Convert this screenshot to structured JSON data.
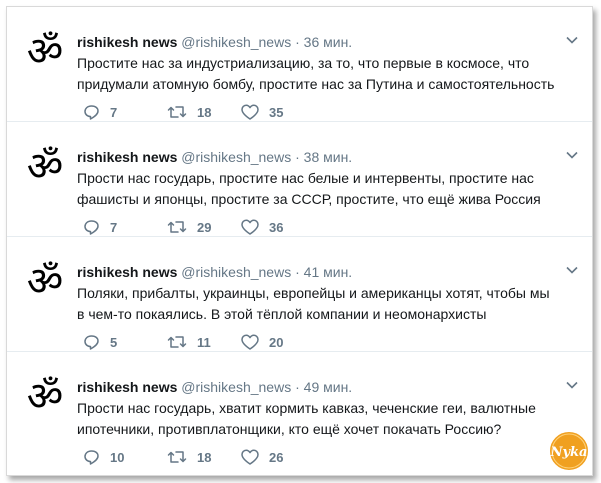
{
  "tweets": [
    {
      "name": "rishikesh news",
      "handle": "@rishikesh_news",
      "separator": "·",
      "time": "36 мин.",
      "text": "Простите нас за индустриализацию, за то, что первые в космосе, что придумали атомную бомбу, простите нас за Путина и самостоятельность",
      "replies": "7",
      "retweets": "18",
      "likes": "35"
    },
    {
      "name": "rishikesh news",
      "handle": "@rishikesh_news",
      "separator": "·",
      "time": "38 мин.",
      "text": "Прости нас государь, простите нас белые и интервенты, простите нас фашисты и японцы, простите за СССР, простите, что ещё жива Россия",
      "replies": "7",
      "retweets": "29",
      "likes": "36"
    },
    {
      "name": "rishikesh news",
      "handle": "@rishikesh_news",
      "separator": "·",
      "time": "41 мин.",
      "text": "Поляки, прибалты, украинцы, европейцы и американцы хотят, чтобы мы в чем-то покаялись. В этой тёплой компании и неомонархисты",
      "replies": "5",
      "retweets": "11",
      "likes": "20"
    },
    {
      "name": "rishikesh news",
      "handle": "@rishikesh_news",
      "separator": "·",
      "time": "49 мин.",
      "text": "Прости нас государь, хватит кормить кавказ, чеченские геи, валютные ипотечники, противплатонщики, кто ещё хочет покачать Россию?",
      "replies": "10",
      "retweets": "18",
      "likes": "26"
    }
  ],
  "watermark": {
    "text": "Nyka",
    "color": "#f0a020"
  },
  "colors": {
    "text": "#14171a",
    "muted": "#657786",
    "divider": "#e6ecf0"
  },
  "icons": [
    "om-avatar-icon",
    "chevron-down-icon",
    "reply-icon",
    "retweet-icon",
    "like-icon"
  ]
}
